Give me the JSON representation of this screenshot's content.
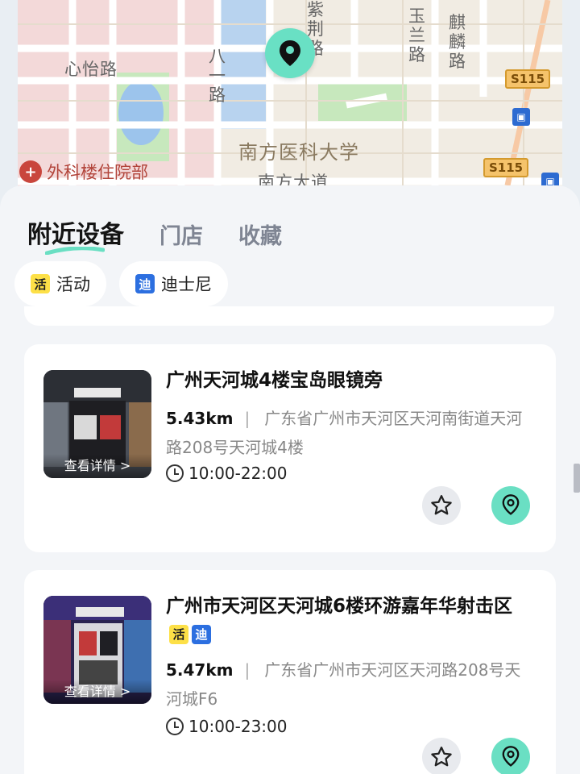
{
  "map": {
    "streets": [
      "心怡路",
      "八一路",
      "紫荆路",
      "玉兰路",
      "麒麟路",
      "南方医科大学",
      "南方大道"
    ],
    "routes": [
      "S115",
      "S115"
    ],
    "poi": "外科楼住院部"
  },
  "tabs": [
    {
      "label": "附近设备",
      "active": true
    },
    {
      "label": "门店",
      "active": false
    },
    {
      "label": "收藏",
      "active": false
    }
  ],
  "filters": [
    {
      "badge": "活",
      "label": "活动",
      "badge_color": "#fde047"
    },
    {
      "badge": "迪",
      "label": "迪士尼",
      "badge_color": "#2c6fe0"
    }
  ],
  "devices": [
    {
      "title": "广州天河城4楼宝岛眼镜旁",
      "tags": [],
      "distance": "5.43km",
      "address": "广东省广州市天河区天河南街道天河路208号天河城4楼",
      "hours": "10:00-22:00",
      "thumb_label": "查看详情 >"
    },
    {
      "title": "广州市天河区天河城6楼环游嘉年华射击区",
      "tags": [
        "活",
        "迪"
      ],
      "distance": "5.47km",
      "address": "广东省广州市天河区天河路208号天河城F6",
      "hours": "10:00-23:00",
      "thumb_label": "查看详情 >"
    }
  ],
  "colors": {
    "accent": "#6adfc3",
    "sheet_bg": "#f3f5f8"
  }
}
